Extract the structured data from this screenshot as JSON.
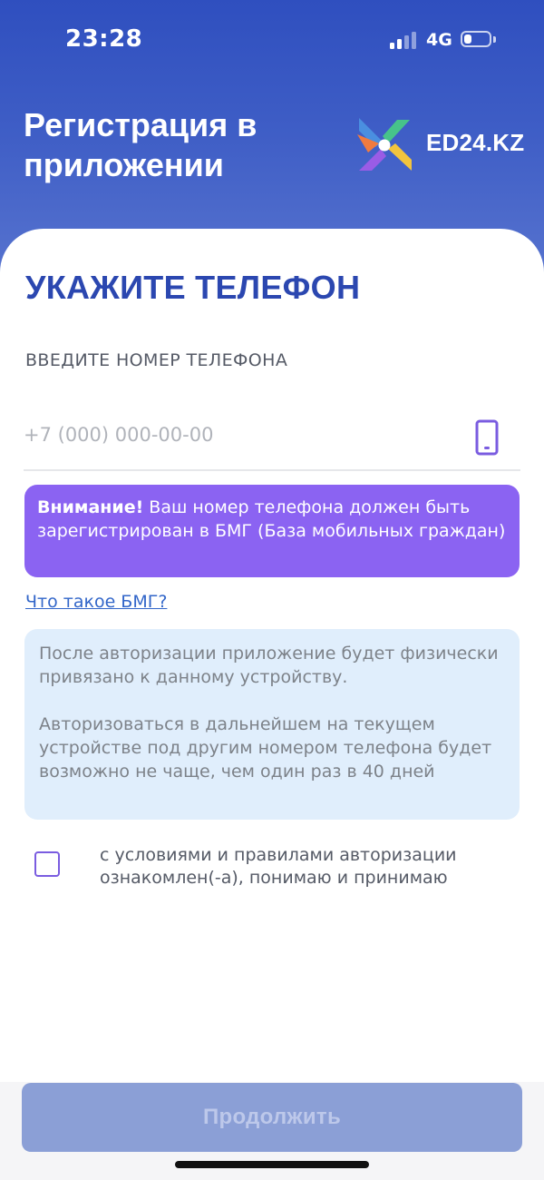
{
  "status_bar": {
    "time": "23:28",
    "network": "4G",
    "signal_bars_active": 2,
    "signal_bars_total": 4,
    "battery_level": 0.3
  },
  "header": {
    "title": "Регистрация в приложении",
    "brand": "ED24.KZ"
  },
  "form": {
    "section_title": "УКАЖИТЕ ТЕЛЕФОН",
    "phone_label": "ВВЕДИТЕ НОМЕР ТЕЛЕФОНА",
    "phone_placeholder": "+7 (000) 000-00-00",
    "phone_value": "",
    "phone_icon": "smartphone-icon"
  },
  "warning": {
    "bold": "Внимание!",
    "text": " Ваш номер телефона должен быть зарегистрирован в БМГ (База мобильных граждан)"
  },
  "bmg_link": "Что такое БМГ?",
  "info": {
    "paragraph1": "После авторизации приложение будет физически привязано к данному устройству.",
    "paragraph2": "Авторизоваться в дальнейшем на текущем устройстве под другим номером телефона будет возможно не чаще, чем один раз в 40 дней"
  },
  "agreement": {
    "checked": false,
    "label": "с условиями и правилами авторизации ознакомлен(-а), понимаю и принимаю"
  },
  "continue_label": "Продолжить",
  "colors": {
    "header_blue": "#2f4fbf",
    "title_blue": "#2b47b0",
    "warning_purple": "#8b63f2",
    "info_bg": "#e0eefc",
    "link_blue": "#3266c9",
    "button_disabled": "#8b9fd6"
  }
}
